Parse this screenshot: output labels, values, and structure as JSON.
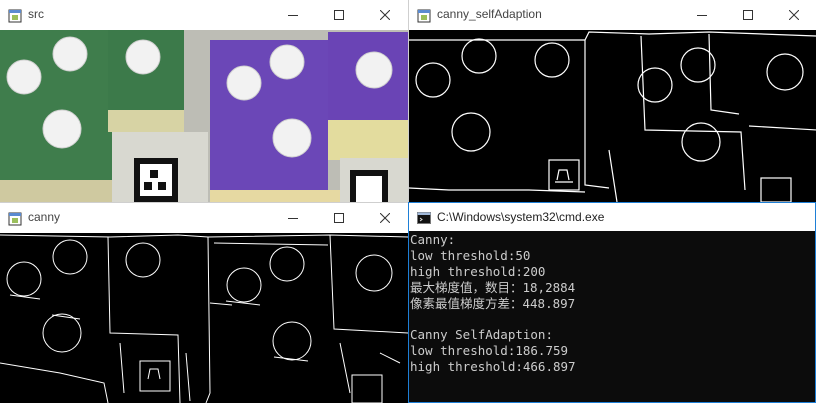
{
  "windows": {
    "src": {
      "title": "src"
    },
    "canny_self": {
      "title": "canny_selfAdaption"
    },
    "canny": {
      "title": "canny"
    },
    "cmd": {
      "title": "C:\\Windows\\system32\\cmd.exe"
    }
  },
  "cmd_output": {
    "line1": "Canny:",
    "line2": "low threshold:50",
    "line3": "high threshold:200",
    "line4": "最大梯度值，数目：18,2884",
    "line5": "像素最值梯度方差：448.897",
    "line6": "",
    "line7": "Canny SelfAdaption:",
    "line8": "low threshold:186.759",
    "line9": "high threshold:466.897"
  },
  "colors": {
    "green_paper": "#3f7d4c",
    "purple_paper": "#6b47b7",
    "console_bg": "#0c0c0c",
    "console_text": "#cccccc",
    "accent_border": "#1e7fd6"
  },
  "icons": {
    "window": "opencv-window-icon",
    "cmd": "cmd-icon",
    "minimize": "minimize-icon",
    "maximize": "maximize-icon",
    "close": "close-icon"
  }
}
